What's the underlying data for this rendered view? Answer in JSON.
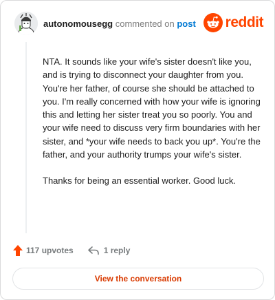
{
  "comment": {
    "author": "autonomousegg",
    "commented_text": "commented on",
    "post_link": "post",
    "paragraphs": [
      "NTA. It sounds like your wife's sister doesn't like you, and is trying to disconnect your daughter from you. You're her father, of course she should be attached to you. I'm really concerned with how your wife is ignoring this and letting her sister treat you so poorly. You and your wife need to discuss very firm boundaries with her sister, and *your wife needs to back you up*. You're the father, and your authority trumps your wife's sister.",
      "Thanks for being an essential worker. Good luck."
    ]
  },
  "brand": {
    "wordmark": "reddit",
    "color": "#ff4500"
  },
  "actions": {
    "upvotes_label": "117 upvotes",
    "replies_label": "1 reply",
    "upvote_color": "#ff4500"
  },
  "footer": {
    "view_button": "View the conversation"
  }
}
